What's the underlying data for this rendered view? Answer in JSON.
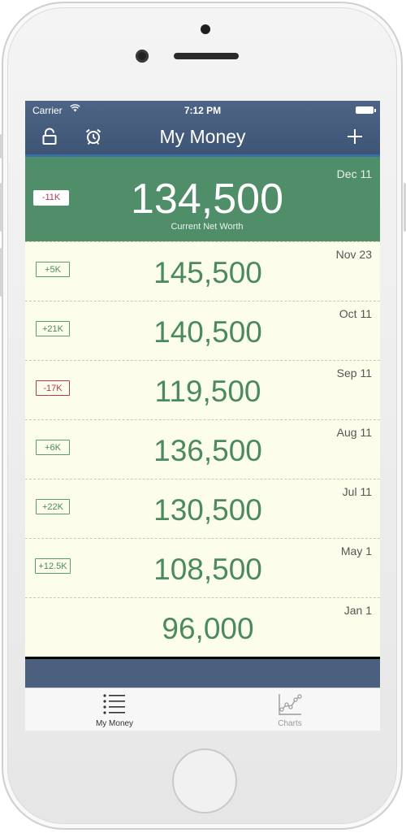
{
  "status_bar": {
    "carrier": "Carrier",
    "time": "7:12 PM"
  },
  "nav": {
    "title": "My Money",
    "icons": [
      "lock-icon",
      "alarm-clock-icon",
      "plus-icon"
    ]
  },
  "current": {
    "date": "Dec 11",
    "amount": "134,500",
    "label": "Current Net Worth",
    "change": "-11K"
  },
  "entries": [
    {
      "date": "Nov 23",
      "amount": "145,500",
      "change": "+5K",
      "negative": false
    },
    {
      "date": "Oct 11",
      "amount": "140,500",
      "change": "+21K",
      "negative": false
    },
    {
      "date": "Sep 11",
      "amount": "119,500",
      "change": "-17K",
      "negative": true
    },
    {
      "date": "Aug 11",
      "amount": "136,500",
      "change": "+6K",
      "negative": false
    },
    {
      "date": "Jul 11",
      "amount": "130,500",
      "change": "+22K",
      "negative": false
    },
    {
      "date": "May 1",
      "amount": "108,500",
      "change": "+12.5K",
      "negative": false
    },
    {
      "date": "Jan 1",
      "amount": "96,000",
      "change": "",
      "negative": false
    }
  ],
  "tabs": [
    {
      "label": "My Money",
      "icon": "list-icon",
      "active": true
    },
    {
      "label": "Charts",
      "icon": "line-chart-icon",
      "active": false
    }
  ],
  "colors": {
    "nav": "#455b7b",
    "current_bg": "#4f8e68",
    "row_bg": "#fdfdec",
    "positive": "#4b8a60",
    "negative": "#b3394f"
  }
}
